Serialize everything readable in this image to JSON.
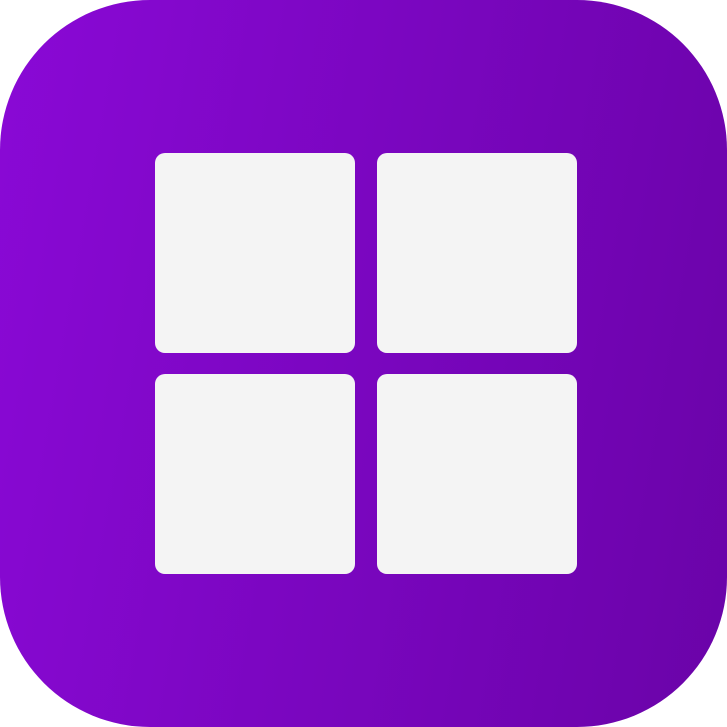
{
  "icon": {
    "name": "grid-icon",
    "gradient_start": "#8a09d6",
    "gradient_end": "#6a03a8",
    "tile_color": "#f4f4f4"
  },
  "tiles": [
    {
      "name": "top-left"
    },
    {
      "name": "top-right"
    },
    {
      "name": "bottom-left"
    },
    {
      "name": "bottom-right"
    }
  ]
}
